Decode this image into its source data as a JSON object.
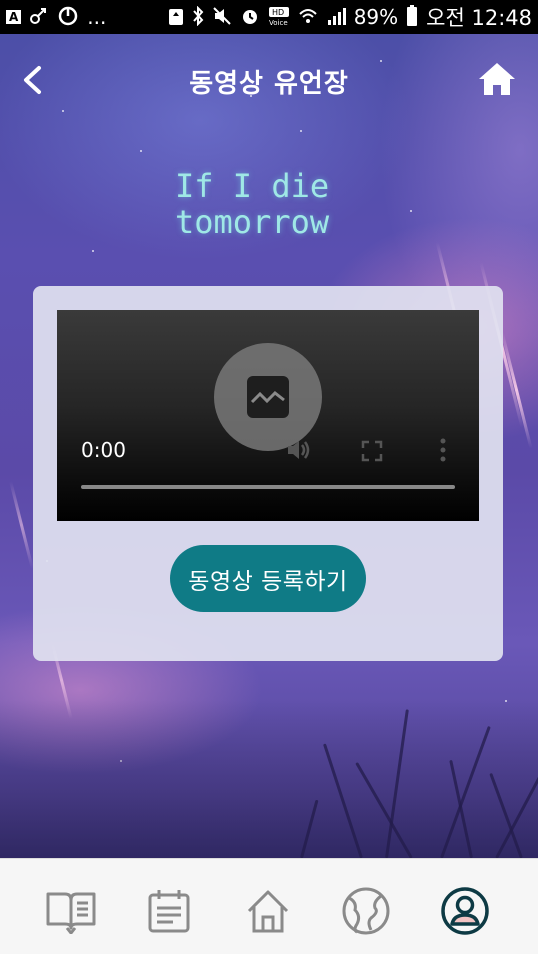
{
  "status_bar": {
    "left_text": "A",
    "dots": "...",
    "battery": "89%",
    "time": "오전 12:48"
  },
  "header": {
    "title": "동영상 유언장"
  },
  "hero": {
    "line1": "If I die",
    "line2": "tomorrow"
  },
  "video": {
    "current_time": "0:00",
    "progress": 0
  },
  "actions": {
    "register_label": "동영상 등록하기"
  },
  "bottom_nav": {
    "items": [
      {
        "icon": "book-icon",
        "active": false
      },
      {
        "icon": "calendar-icon",
        "active": false
      },
      {
        "icon": "home-icon",
        "active": false
      },
      {
        "icon": "globe-icon",
        "active": false
      },
      {
        "icon": "profile-icon",
        "active": true
      }
    ]
  },
  "colors": {
    "accent": "#0f7b86",
    "nav_inactive": "#8a8a8a",
    "nav_active": "#0d3a44"
  }
}
